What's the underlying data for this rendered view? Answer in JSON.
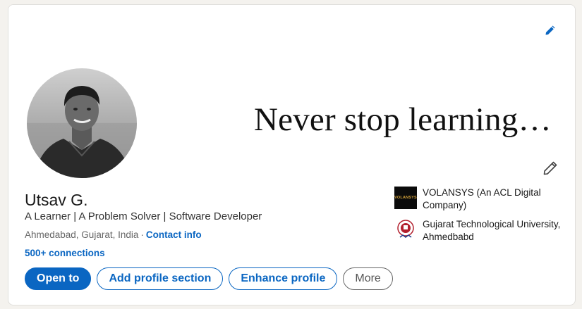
{
  "banner": {
    "text": "Never stop learning…"
  },
  "profile": {
    "name": "Utsav G.",
    "headline": "A Learner | A Problem Solver | Software Developer",
    "location": "Ahmedabad, Gujarat, India",
    "separator": "·",
    "contact_info": "Contact info",
    "connections": "500+ connections"
  },
  "actions": {
    "open_to": "Open to",
    "add_section": "Add profile section",
    "enhance": "Enhance profile",
    "more": "More"
  },
  "organizations": [
    {
      "name": "VOLANSYS (An ACL Digital Company)",
      "logo_text": "VOLANSYS",
      "icon": "volansys-logo"
    },
    {
      "name": "Gujarat Technological University, Ahmedbabd",
      "icon": "gtu-logo"
    }
  ],
  "colors": {
    "accent": "#0a66c2",
    "background": "#f4f2ee"
  },
  "icons": {
    "banner_edit": "pencil-icon",
    "profile_edit": "pencil-icon"
  }
}
